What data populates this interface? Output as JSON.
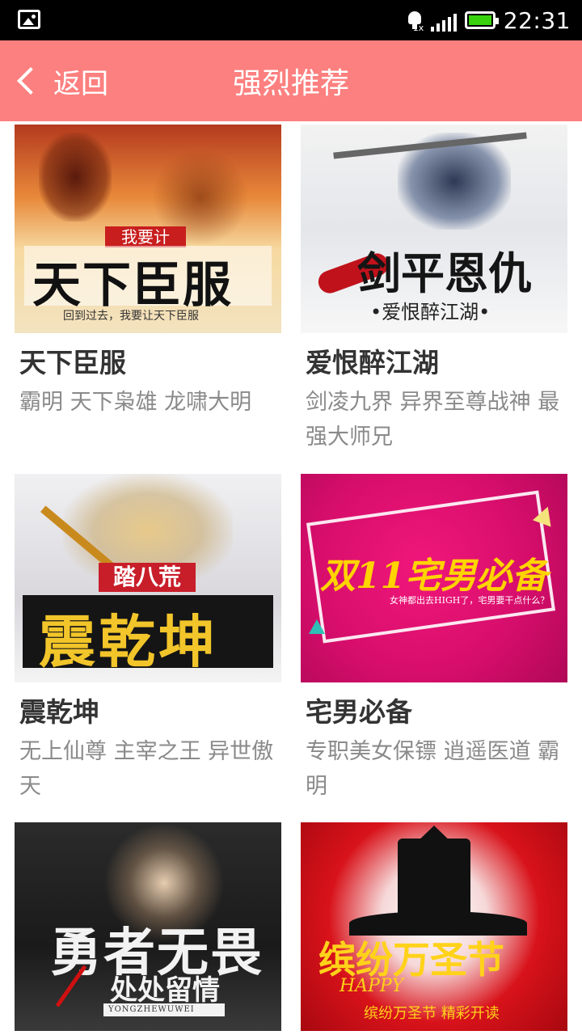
{
  "status_bar": {
    "time": "22:31",
    "network_label": "1x"
  },
  "nav": {
    "back_label": "返回",
    "title": "强烈推荐"
  },
  "books": [
    {
      "title": "天下臣服",
      "tags": "霸明  天下枭雄  龙啸大明",
      "cover": {
        "top_text": "我要计",
        "main_text": "天下臣服",
        "sub_text": "回到过去，我要让天下臣服"
      }
    },
    {
      "title": "爱恨醉江湖",
      "tags": "剑凌九界  异界至尊战神  最强大师兄",
      "cover": {
        "main_text": "剑平恩仇",
        "sub_text": "•爱恨醉江湖•"
      }
    },
    {
      "title": "震乾坤",
      "tags": "无上仙尊  主宰之王  异世傲天",
      "cover": {
        "top_text": "踏八荒",
        "main_text": "震乾坤"
      }
    },
    {
      "title": "宅男必备",
      "tags": "专职美女保镖  逍遥医道  霸明",
      "cover": {
        "main_text": "双11宅男必备",
        "sub_text": "女神都出去HIGH了，宅男要干点什么？"
      }
    },
    {
      "title": "",
      "tags": "",
      "cover": {
        "main_text": "勇者无畏",
        "second_text": "处处留情",
        "sub_text": "YONGZHEWUWEI"
      }
    },
    {
      "title": "",
      "tags": "",
      "cover": {
        "main_text": "缤纷万圣节",
        "accent_text": "HAPPY",
        "sub_text": "缤纷万圣节 精彩开读"
      }
    }
  ]
}
